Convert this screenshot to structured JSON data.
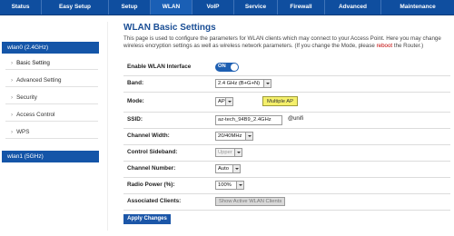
{
  "nav": {
    "tabs": [
      "Status",
      "Easy Setup",
      "Setup",
      "WLAN",
      "VoIP",
      "Service",
      "Firewall",
      "Advanced",
      "Maintenance"
    ],
    "active": "WLAN",
    "color": "#0f4e9f"
  },
  "sidebar": {
    "group1": "wlan0 (2.4GHz)",
    "items": [
      "Basic Setting",
      "Advanced Setting",
      "Security",
      "Access Control",
      "WPS"
    ],
    "active_item": "Basic Setting",
    "group2": "wlan1 (5GHz)"
  },
  "page": {
    "title": "WLAN Basic Settings",
    "desc_main": "This page is used to configure the parameters for WLAN clients which may connect to your Access Point. Here you may change wireless encryption settings as well as wireless network parameters. (If you change the Mode, please ",
    "desc_red": "reboot",
    "desc_tail": " the Router.)"
  },
  "form": {
    "enable": {
      "label": "Enable WLAN Interface",
      "value": "ON"
    },
    "band": {
      "label": "Band:",
      "value": "2.4 GHz (B+G+N)"
    },
    "mode": {
      "label": "Mode:",
      "value": "AP",
      "button": "Multiple AP"
    },
    "ssid": {
      "label": "SSID:",
      "value": "az-tech_94B9_2.4GHz",
      "suffix": "@unifi"
    },
    "channel_width": {
      "label": "Channel Width:",
      "value": "20/40MHz"
    },
    "sideband": {
      "label": "Control Sideband:",
      "value": "Upper"
    },
    "channel_number": {
      "label": "Channel Number:",
      "value": "Auto"
    },
    "radio_power": {
      "label": "Radio Power (%):",
      "value": "100%"
    },
    "assoc": {
      "label": "Associated Clients:",
      "button": "Show Active WLAN Clients"
    }
  },
  "apply_label": "Apply Changes"
}
